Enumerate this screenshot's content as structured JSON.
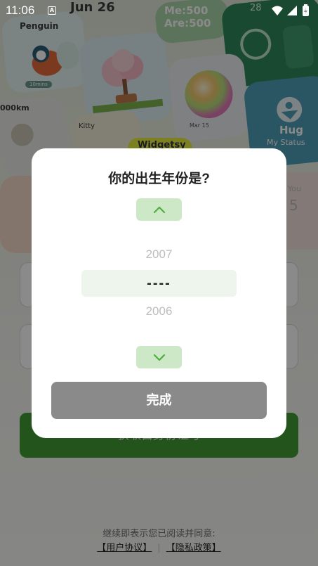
{
  "status_bar": {
    "time": "11:06",
    "notification_icon": "A"
  },
  "background": {
    "widget_texts": {
      "date": "Jun 26",
      "penguin": "Penguin",
      "timer": "10mins",
      "me": "Me:500",
      "are": "Are:500",
      "count": "28",
      "mar": "Mar 15",
      "hug": "Hug",
      "hug_sub": "My Status",
      "km": "000km",
      "kitty": "Kitty",
      "widget_tag": "Widgetsy",
      "you": "You",
      "five": "5"
    },
    "start_button_label": "获取自身份证号",
    "agreement_text": "继续即表示您已阅读并同意:",
    "user_agreement": "【用户协议】",
    "privacy_policy": "【隐私政策】"
  },
  "dialog": {
    "title": "你的出生年份是?",
    "picker": {
      "previous": "2007",
      "selected": "----",
      "next": "2006"
    },
    "up_icon": "chevron-up-icon",
    "down_icon": "chevron-down-icon",
    "done_label": "完成"
  },
  "colors": {
    "accent_green": "#5bb24a",
    "arrow_bg": "#cde8c7",
    "selected_bg": "#edf5ec",
    "done_bg": "#8a8a8a"
  }
}
